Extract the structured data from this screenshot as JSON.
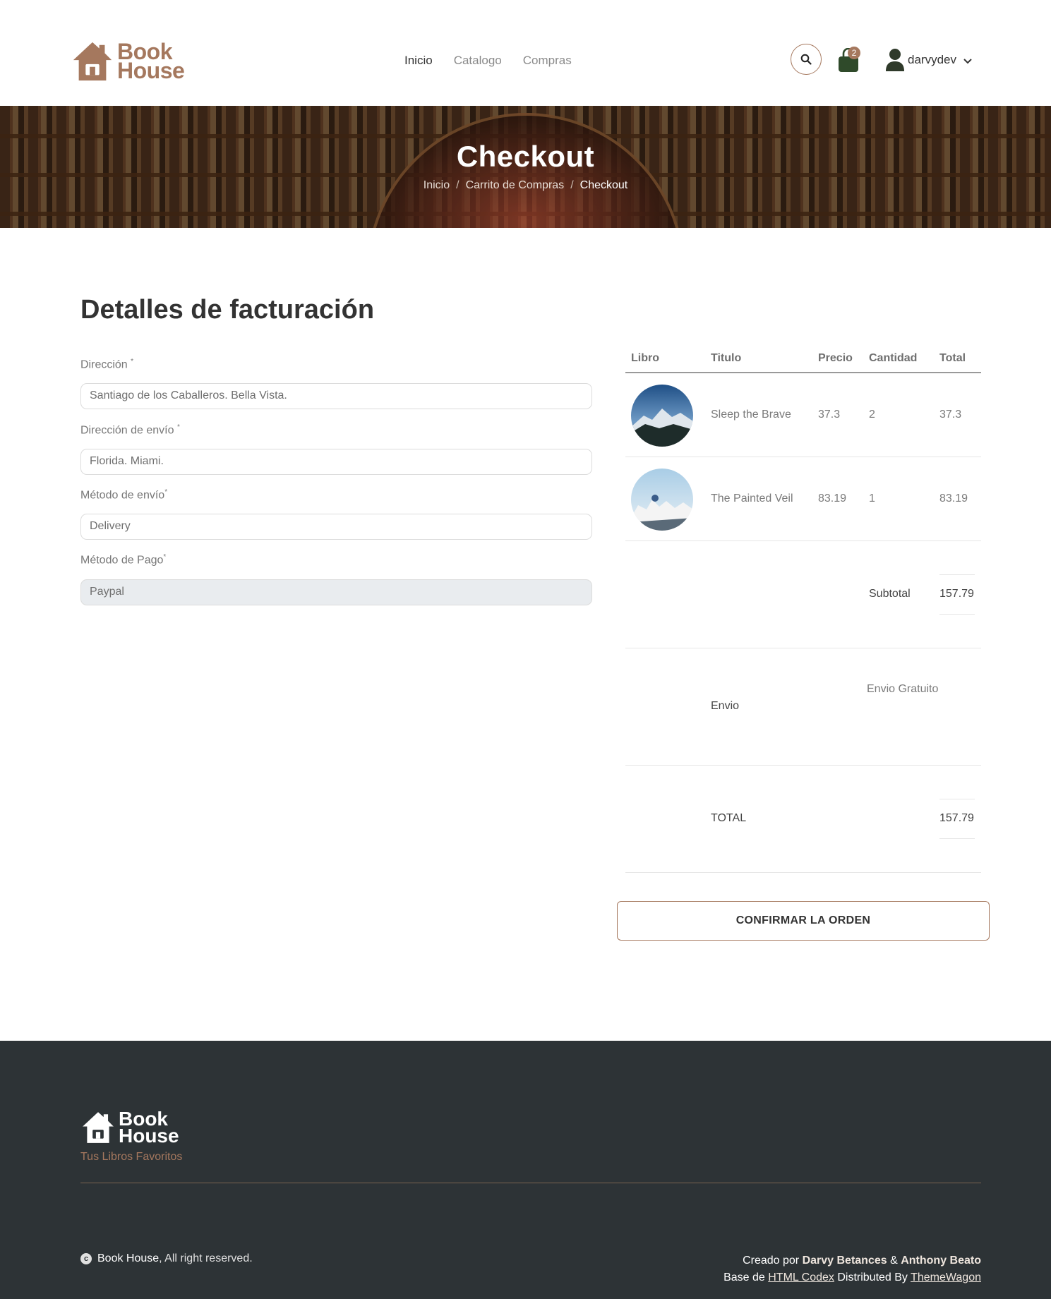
{
  "brand": {
    "line1": "Book",
    "line2": "House",
    "color": "#a5785e"
  },
  "nav": {
    "items": [
      {
        "label": "Inicio",
        "active": true
      },
      {
        "label": "Catalogo",
        "active": false
      },
      {
        "label": "Compras",
        "active": false
      }
    ]
  },
  "header": {
    "cart_count": "2",
    "username": "darvydev",
    "icons": [
      "search-icon",
      "shopping-bag-icon",
      "user-icon",
      "chevron-down-icon"
    ]
  },
  "hero": {
    "title": "Checkout",
    "breadcrumb": [
      "Inicio",
      "Carrito de Compras",
      "Checkout"
    ]
  },
  "billing": {
    "title": "Detalles de facturación",
    "fields": [
      {
        "label": "Dirección",
        "required": "*",
        "value": "Santiago de los Caballeros. Bella Vista."
      },
      {
        "label": "Dirección de envío",
        "required": "*",
        "value": "Florida. Miami."
      },
      {
        "label": "Método de envío",
        "required": "*",
        "value": "Delivery"
      },
      {
        "label": "Método de Pago",
        "required": "*",
        "value": "Paypal",
        "disabled": true
      }
    ]
  },
  "order": {
    "columns": [
      "Libro",
      "Titulo",
      "Precio",
      "Cantidad",
      "Total"
    ],
    "rows": [
      {
        "title": "Sleep the Brave",
        "price": "37.3",
        "qty": "2",
        "total": "37.3"
      },
      {
        "title": "The Painted Veil",
        "price": "83.19",
        "qty": "1",
        "total": "83.19"
      }
    ],
    "subtotal_label": "Subtotal",
    "subtotal_value": "157.79",
    "shipping_label": "Envio",
    "shipping_value": "Envio Gratuito",
    "total_label": "TOTAL",
    "total_value": "157.79",
    "confirm_label": "CONFIRMAR LA ORDEN"
  },
  "footer": {
    "brand_line1": "Book",
    "brand_line2": "House",
    "tagline": "Tus Libros Favoritos",
    "copyright_icon": "c",
    "copyright_brand": "Book House",
    "copyright_text": ", All right reserved.",
    "credit_prefix": "Creado por ",
    "author1": "Darvy Betances",
    "amp": " & ",
    "author2": "Anthony Beato",
    "base_prefix": "Base de ",
    "base_link": "HTML Codex",
    "distributed": " Distributed By ",
    "dist_link": "ThemeWagon"
  }
}
